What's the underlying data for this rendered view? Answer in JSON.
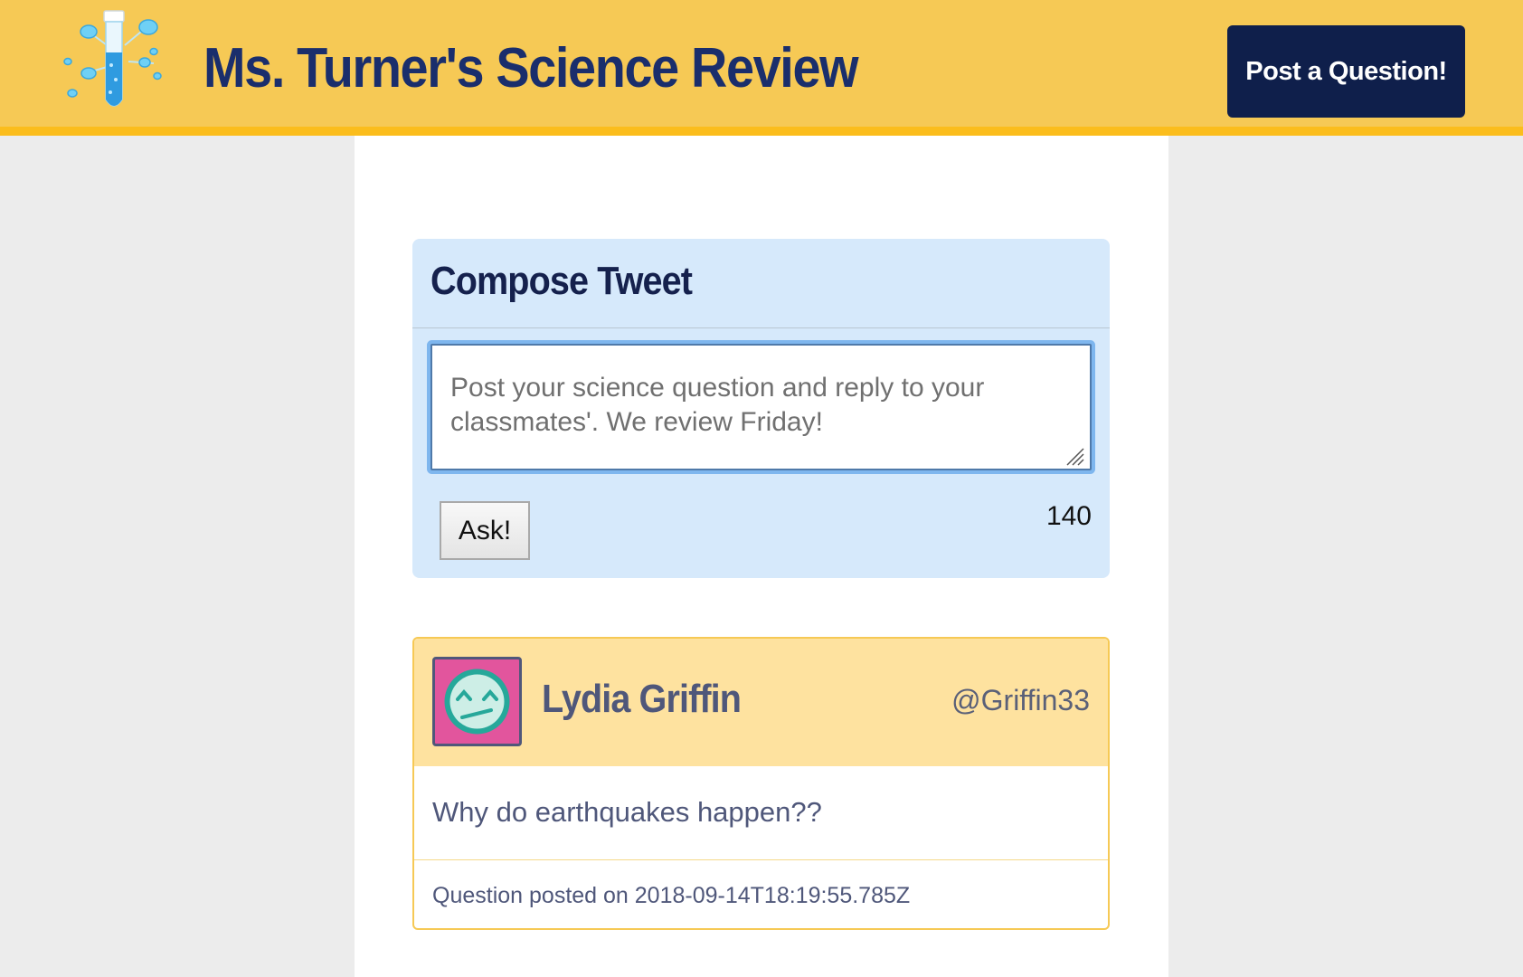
{
  "header": {
    "title": "Ms. Turner's Science Review",
    "logo_icon": "test-tube-icon",
    "post_button_label": "Post a Question!",
    "colors": {
      "bar": "#f6c955",
      "title": "#1a2e6c",
      "button": "#0f1f4b"
    }
  },
  "compose": {
    "title": "Compose Tweet",
    "placeholder": "Post your science question and reply to your classmates'. We review Friday!",
    "ask_button_label": "Ask!",
    "char_count": "140"
  },
  "tweets": [
    {
      "author_name": "Lydia Griffin",
      "handle": "@Griffin33",
      "avatar_icon": "grimace-face-icon",
      "text": "Why do earthquakes happen??",
      "footer": "Question posted on 2018-09-14T18:19:55.785Z"
    }
  ]
}
